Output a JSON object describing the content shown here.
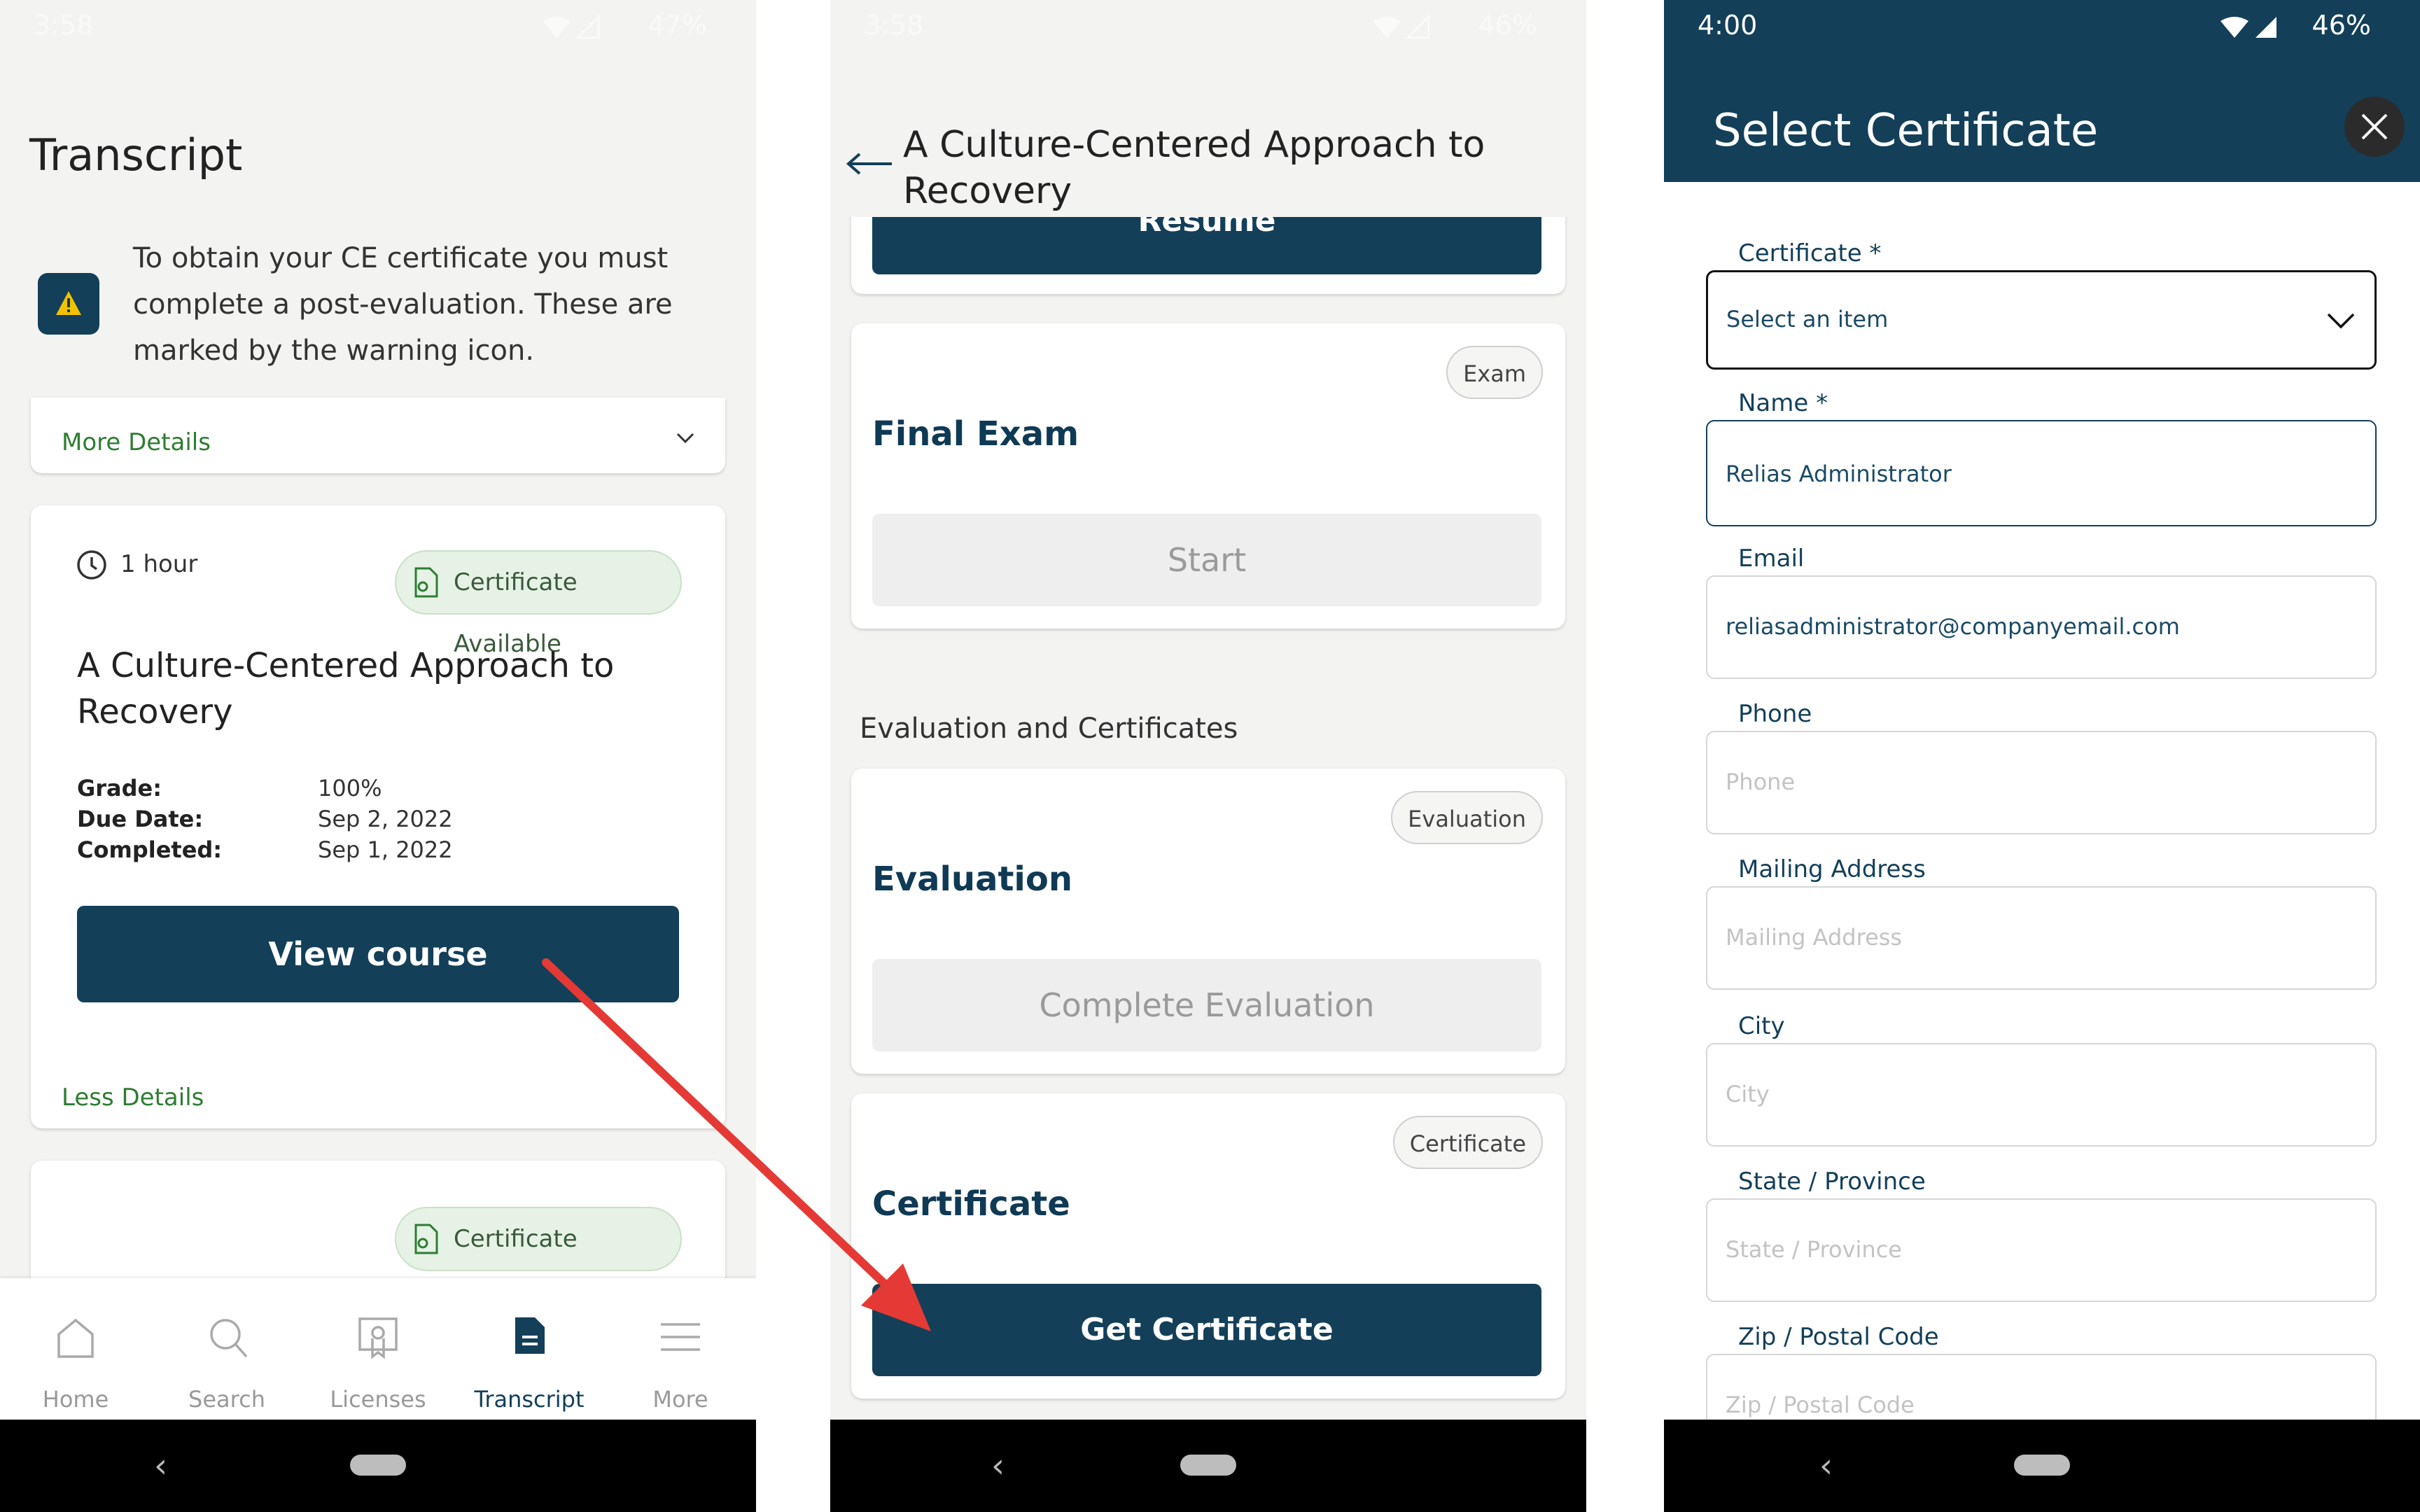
{
  "panel1": {
    "status": {
      "time": "3:58",
      "battery": "47%"
    },
    "page_title": "Transcript",
    "notice_text": "To obtain your CE certificate you must complete a post-evaluation. These are marked by the warning icon.",
    "more_details": "More Details",
    "course": {
      "duration": "1 hour",
      "badge": "Certificate Available",
      "title": "A Culture-Centered Approach to Recovery",
      "grade_label": "Grade:",
      "grade": "100%",
      "due_label": "Due Date:",
      "due": "Sep 2, 2022",
      "completed_label": "Completed:",
      "completed": "Sep 1, 2022",
      "view_button": "View course",
      "less_details": "Less Details"
    },
    "second_card_badge": "Certificate Available",
    "tabbar": [
      {
        "label": "Home",
        "icon": "home-icon"
      },
      {
        "label": "Search",
        "icon": "search-icon"
      },
      {
        "label": "Licenses",
        "icon": "license-icon"
      },
      {
        "label": "Transcript",
        "icon": "transcript-icon",
        "active": true
      },
      {
        "label": "More",
        "icon": "menu-icon"
      }
    ]
  },
  "panel2": {
    "status": {
      "time": "3:58",
      "battery": "46%"
    },
    "header_title": "A Culture-Centered Approach to Recovery",
    "resume_button": "Resume",
    "final_exam": {
      "badge": "Exam",
      "title": "Final Exam",
      "button": "Start"
    },
    "section_label": "Evaluation and Certificates",
    "evaluation": {
      "badge": "Evaluation",
      "title": "Evaluation",
      "button": "Complete Evaluation"
    },
    "certificate": {
      "badge": "Certificate",
      "title": "Certificate",
      "button": "Get Certificate"
    }
  },
  "panel3": {
    "status": {
      "time": "4:00",
      "battery": "46%"
    },
    "title": "Select Certificate",
    "fields": {
      "certificate": {
        "label": "Certificate *",
        "value": "Select an item"
      },
      "name": {
        "label": "Name *",
        "value": "Relias Administrator"
      },
      "email": {
        "label": "Email",
        "value": "reliasadministrator@companyemail.com"
      },
      "phone": {
        "label": "Phone",
        "placeholder": "Phone"
      },
      "mailing": {
        "label": "Mailing Address",
        "placeholder": "Mailing Address"
      },
      "city": {
        "label": "City",
        "placeholder": "City"
      },
      "state": {
        "label": "State / Province",
        "placeholder": "State / Province"
      },
      "zip": {
        "label": "Zip / Postal Code",
        "placeholder": "Zip / Postal Code"
      }
    }
  },
  "colors": {
    "primary": "#133f59",
    "green": "#2e7d32",
    "warning": "#f2c200",
    "arrow": "#e53935"
  }
}
